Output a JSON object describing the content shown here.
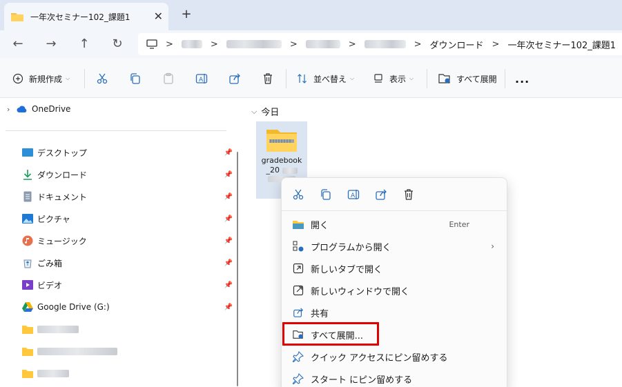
{
  "tab": {
    "title": "一年次セミナー102_課題1",
    "close": "✕",
    "new": "+"
  },
  "address": {
    "crumbs": [
      "ダウンロード",
      "一年次セミナー102_課題1"
    ],
    "sep": ">"
  },
  "toolbar": {
    "new_label": "新規作成",
    "sort_label": "並べ替え",
    "view_label": "表示",
    "extract_label": "すべて展開",
    "more_label": "..."
  },
  "nav": {
    "onedrive": "OneDrive",
    "items": [
      {
        "label": "デスクトップ"
      },
      {
        "label": "ダウンロード"
      },
      {
        "label": "ドキュメント"
      },
      {
        "label": "ピクチャ"
      },
      {
        "label": "ミュージック"
      },
      {
        "label": "ごみ箱"
      },
      {
        "label": "ビデオ"
      },
      {
        "label": "Google Drive (G:)"
      }
    ]
  },
  "content": {
    "group_header": "今日",
    "file_name": "gradebook _20"
  },
  "context_menu": {
    "items": [
      {
        "label": "開く",
        "shortcut": "Enter"
      },
      {
        "label": "プログラムから開く"
      },
      {
        "label": "新しいタブで開く"
      },
      {
        "label": "新しいウィンドウで開く"
      },
      {
        "label": "共有"
      },
      {
        "label": "すべて展開..."
      },
      {
        "label": "クイック アクセスにピン留めする"
      },
      {
        "label": "スタート にピン留めする"
      }
    ]
  }
}
